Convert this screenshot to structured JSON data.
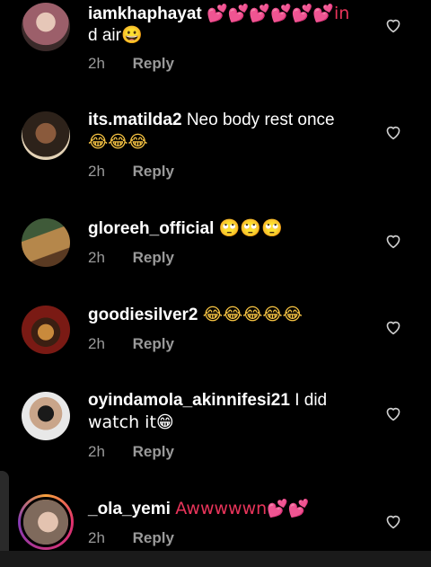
{
  "comments": [
    {
      "username": "iamkhaphayat",
      "text_line1": "💕💕💕💕💕💕in",
      "text_line2": "d air😀",
      "time": "2h",
      "reply": "Reply",
      "avatar_color": "#7d5a5e"
    },
    {
      "username": "its.matilda2",
      "text_line1": "Neo body rest once",
      "text_line2": "😂😂😂",
      "time": "2h",
      "reply": "Reply",
      "avatar_color": "#4a3b2f"
    },
    {
      "username": "gloreeh_official",
      "text_line1": "🙄🙄🙄",
      "text_line2": "",
      "time": "2h",
      "reply": "Reply",
      "avatar_color": "#6b4b2a"
    },
    {
      "username": "goodiesilver2",
      "text_line1": "😂😂😂😂😂",
      "text_line2": "",
      "time": "2h",
      "reply": "Reply",
      "avatar_color": "#7a1a14"
    },
    {
      "username": "oyindamola_akinnifesi21",
      "text_line1": "I did",
      "text_line2": "watch it😁",
      "time": "2h",
      "reply": "Reply",
      "avatar_color": "#d8d8d8"
    },
    {
      "username": "_ola_yemi",
      "text_line1": "Awwwwwn💕💕",
      "text_line2": "",
      "time": "2h",
      "reply": "Reply",
      "avatar_color": "#8d7a6a"
    }
  ],
  "icons": {
    "like": "heart-outline-icon"
  }
}
